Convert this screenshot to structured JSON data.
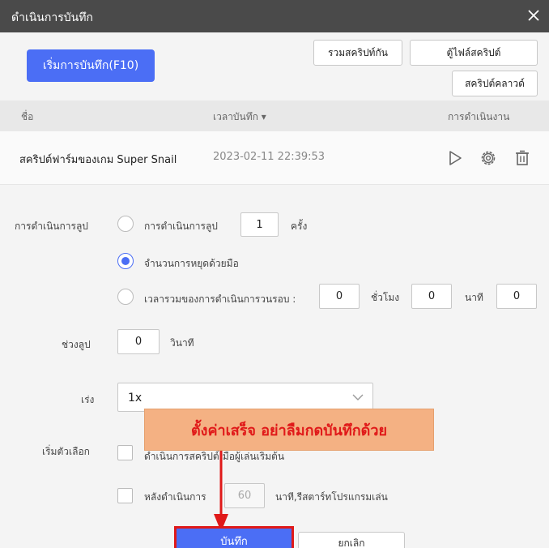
{
  "window": {
    "title": "ดำเนินการบันทึก"
  },
  "toolbar": {
    "start_record_label": "เริ่มการบันทึก(F10)",
    "merge_scripts_label": "รวมสคริปท์กัน",
    "script_cabinet_label": "ตู้ไฟล์สคริปต์",
    "cloud_scripts_label": "สคริปต์คลาวด์"
  },
  "table": {
    "columns": {
      "name": "ชื่อ",
      "record_time": "เวลาบันทึก ▾",
      "actions": "การดำเนินงาน"
    },
    "rows": [
      {
        "name": "สคริปต์ฟาร์มของเกม Super Snail",
        "time": "2023-02-11 22:39:53"
      }
    ]
  },
  "settings": {
    "loop_label": "การดำเนินการลูป",
    "loop_option_1": "การดำเนินการลูป",
    "loop_count": "1",
    "times_unit": "ครั้ง",
    "loop_option_2": "จำนวนการหยุดด้วยมือ",
    "loop_option_3": "เวลารวมของการดำเนินการวนรอบ :",
    "hours_value": "0",
    "hours_unit": "ชั่วโมง",
    "minutes_value": "0",
    "minutes_unit": "นาที",
    "seconds_value": "0",
    "interval_label": "ช่วงลูป",
    "interval_value": "0",
    "seconds_unit": "วินาที",
    "speed_label": "เร่ง",
    "speed_value": "1x",
    "start_options_label": "เริ่มตัวเลือก",
    "start_option_1": "ดำเนินการสคริปต์เมื่อผู้เล่นเริ่มต้น",
    "start_option_2_prefix": "หลังดำเนินการ",
    "restart_minutes": "60",
    "start_option_2_suffix": "นาที,รีสตาร์ทโปรแกรมเล่น"
  },
  "annotation": {
    "text": "ตั้งค่าเสร็จ อย่าลืมกดบันทึกด้วย",
    "color": "#e01919"
  },
  "footer": {
    "save_label": "บันทึก",
    "cancel_label": "ยกเลิก"
  },
  "colors": {
    "primary": "#4b6ef5",
    "titlebar": "#4a4a4a",
    "annotation_bg": "#f4b183"
  }
}
